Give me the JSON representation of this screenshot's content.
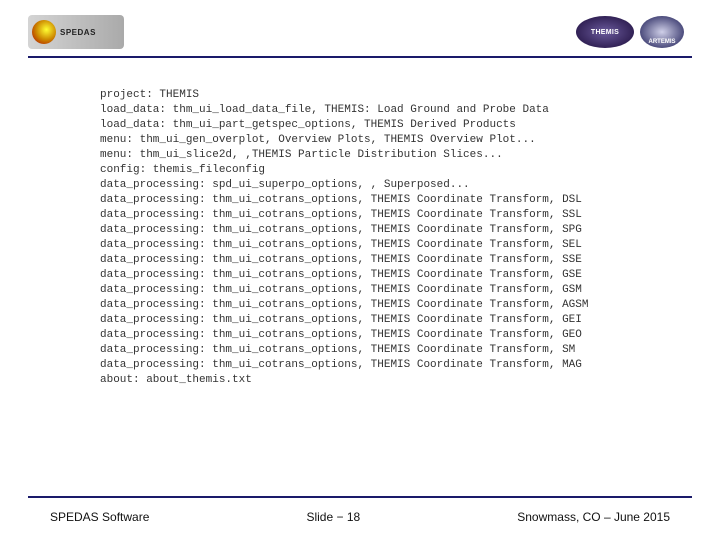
{
  "header": {
    "logo_left_text": "SPEDAS",
    "themis_label": "THEMIS",
    "artemis_label": "ARTEMIS"
  },
  "lines": [
    "project: THEMIS",
    "load_data: thm_ui_load_data_file, THEMIS: Load Ground and Probe Data",
    "load_data: thm_ui_part_getspec_options, THEMIS Derived Products",
    "menu: thm_ui_gen_overplot, Overview Plots, THEMIS Overview Plot...",
    "menu: thm_ui_slice2d, ,THEMIS Particle Distribution Slices...",
    "config: themis_fileconfig",
    "data_processing: spd_ui_superpo_options, , Superposed...",
    "data_processing: thm_ui_cotrans_options, THEMIS Coordinate Transform, DSL",
    "data_processing: thm_ui_cotrans_options, THEMIS Coordinate Transform, SSL",
    "data_processing: thm_ui_cotrans_options, THEMIS Coordinate Transform, SPG",
    "data_processing: thm_ui_cotrans_options, THEMIS Coordinate Transform, SEL",
    "data_processing: thm_ui_cotrans_options, THEMIS Coordinate Transform, SSE",
    "data_processing: thm_ui_cotrans_options, THEMIS Coordinate Transform, GSE",
    "data_processing: thm_ui_cotrans_options, THEMIS Coordinate Transform, GSM",
    "data_processing: thm_ui_cotrans_options, THEMIS Coordinate Transform, AGSM",
    "data_processing: thm_ui_cotrans_options, THEMIS Coordinate Transform, GEI",
    "data_processing: thm_ui_cotrans_options, THEMIS Coordinate Transform, GEO",
    "data_processing: thm_ui_cotrans_options, THEMIS Coordinate Transform, SM",
    "data_processing: thm_ui_cotrans_options, THEMIS Coordinate Transform, MAG",
    "about: about_themis.txt"
  ],
  "footer": {
    "left": "SPEDAS Software",
    "center": "Slide − 18",
    "right": "Snowmass, CO – June 2015"
  }
}
